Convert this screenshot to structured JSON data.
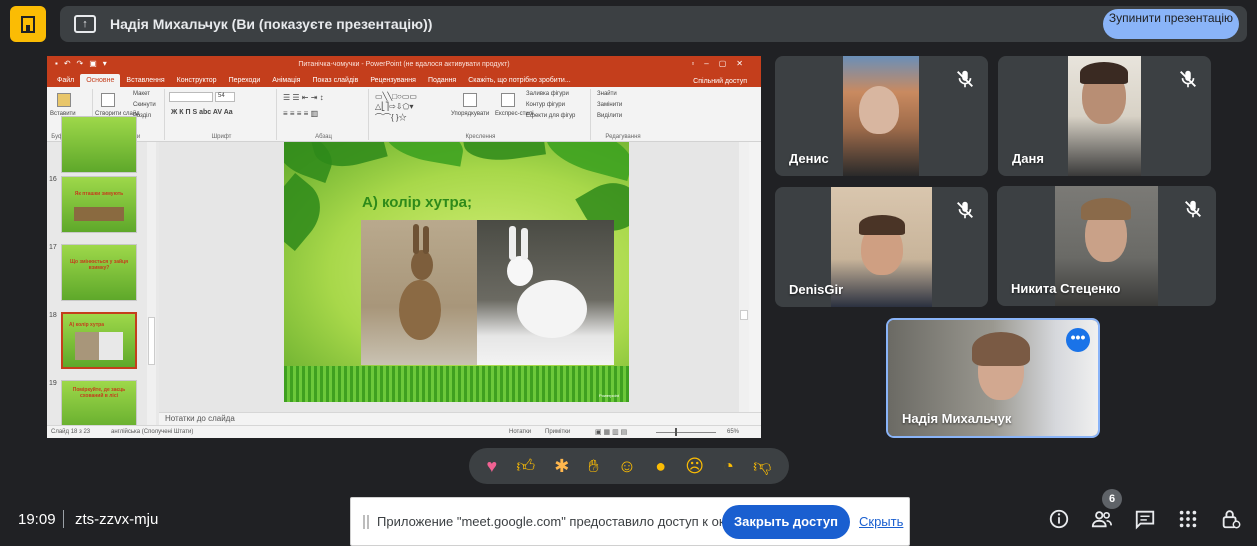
{
  "header": {
    "present_text": "Надія Михальчук (Ви (показуєте презентацію))",
    "stop_button": "Зупинити презентацію"
  },
  "powerpoint": {
    "title": "Питанічка-чомучки - PowerPoint (не вдалося активувати продукт)",
    "tabs": [
      "Файл",
      "Основне",
      "Вставлення",
      "Конструктор",
      "Переходи",
      "Анімація",
      "Показ слайдів",
      "Рецензування",
      "Подання",
      "Скажіть, що потрібно зробити..."
    ],
    "share_label": "Спільний доступ",
    "ribbon": {
      "groups": [
        "Буфер обміну",
        "Слайди",
        "Шрифт",
        "Абзац",
        "Креслення",
        "Редагування"
      ],
      "paste": "Вставити",
      "new_slide": "Створити слайд",
      "layout": "Макет",
      "reset": "Скинути",
      "section": "Розділ",
      "font_size": "54",
      "arrange": "Упорядкувати",
      "quick_styles": "Експрес-стилі",
      "shape_fill": "Заливка фігури",
      "shape_outline": "Контур фігури",
      "shape_effects": "Ефекти для фігур",
      "find": "Знайти",
      "replace": "Замінити",
      "select": "Виділити"
    },
    "thumbnails": [
      {
        "num": "16",
        "text": "Як пташки зимують"
      },
      {
        "num": "17",
        "text": "Що змінюється у зайця взимку?"
      },
      {
        "num": "18",
        "text": "А) колір хутра"
      },
      {
        "num": "19",
        "text": "Поміркуйте, де заєць схований в лісі"
      }
    ],
    "slide": {
      "title": "А) колір хутра;",
      "credit": "Powerpoint"
    },
    "notes_placeholder": "Нотатки до слайда",
    "status": {
      "slide": "Слайд 18 з 23",
      "language": "англійська (Сполучені Штати)",
      "notes": "Нотатки",
      "comments": "Примітки",
      "zoom": "65%"
    }
  },
  "participants": [
    {
      "name": "Денис",
      "muted": true
    },
    {
      "name": "Даня",
      "muted": true
    },
    {
      "name": "DenisGir",
      "muted": true
    },
    {
      "name": "Никита Стеценко",
      "muted": true
    },
    {
      "name": "Надія Михальчук",
      "muted": false
    }
  ],
  "reactions": [
    "sparkling-heart",
    "thumbs-up",
    "party-popper",
    "clapping-hands",
    "tears-of-joy",
    "surprised-face",
    "crying-face",
    "thinking-face",
    "thumbs-down"
  ],
  "footer": {
    "time": "19:09",
    "meeting_code": "zts-zzvx-mju",
    "participant_count": "6",
    "share_message": "Приложение \"meet.google.com\" предоставило доступ к окну.",
    "close_share": "Закрыть доступ",
    "hide": "Скрыть"
  },
  "colors": {
    "background": "#202124",
    "accent_blue": "#8ab4f8",
    "ppt_red": "#c43e1c",
    "logo_yellow": "#fbbc04"
  }
}
